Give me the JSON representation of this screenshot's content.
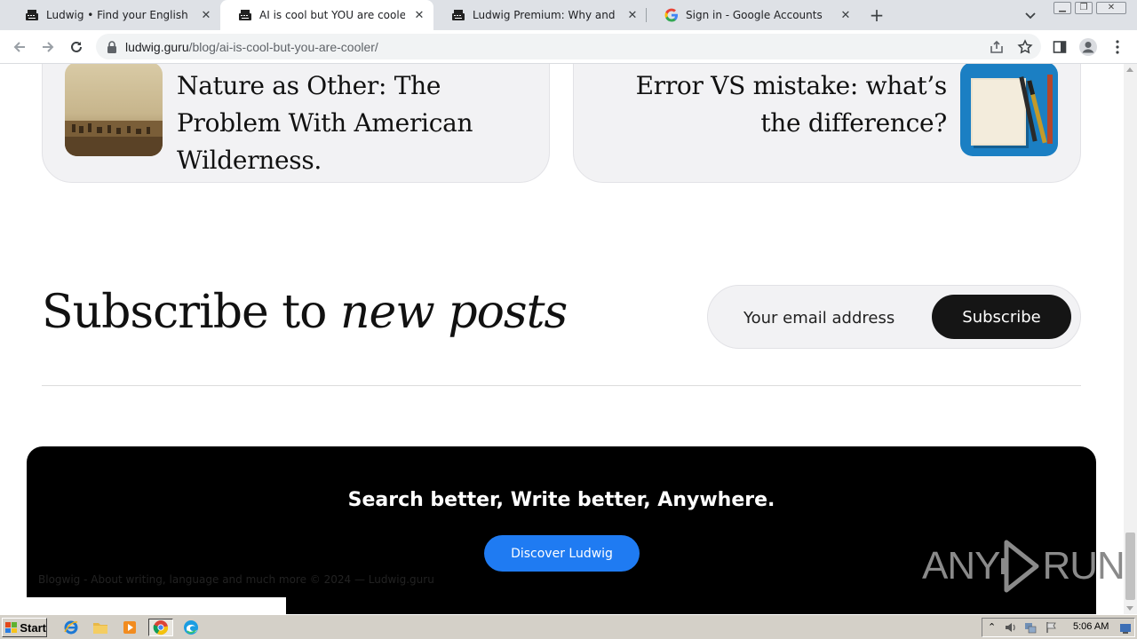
{
  "browser": {
    "tabs": [
      {
        "title": "Ludwig • Find your English sentence",
        "active": false,
        "icon": "ludwig-typewriter-icon"
      },
      {
        "title": "AI is cool but YOU are cooler",
        "active": true,
        "icon": "ludwig-typewriter-icon"
      },
      {
        "title": "Ludwig Premium: Why and How. An",
        "active": false,
        "icon": "ludwig-typewriter-icon"
      },
      {
        "title": "Sign in - Google Accounts",
        "active": false,
        "icon": "google-g-icon"
      }
    ],
    "new_tab": "+",
    "url_domain": "ludwig.guru",
    "url_path": "/blog/ai-is-cool-but-you-are-cooler/"
  },
  "page": {
    "cards": [
      {
        "title": "Nature as Other: The Problem With American Wilderness."
      },
      {
        "title": "Error VS mistake: what’s the difference?"
      }
    ],
    "subscribe": {
      "heading_plain": "Subscribe to ",
      "heading_italic": "new posts",
      "email_placeholder": "Your email address",
      "button_label": "Subscribe"
    },
    "footer": {
      "cta": "Search better, Write better, Anywhere.",
      "button_label": "Discover Ludwig",
      "note": "Blogwig - About writing, language and much more © 2024 — Ludwig.guru"
    },
    "watermark": {
      "left": "ANY",
      "right": "RUN"
    }
  },
  "taskbar": {
    "start_label": "Start",
    "clock": "5:06 AM"
  },
  "colors": {
    "accent_blue": "#1f7bf2",
    "footer_bg": "#000000",
    "subscribe_button": "#151515",
    "card_bg": "#f2f2f4"
  }
}
